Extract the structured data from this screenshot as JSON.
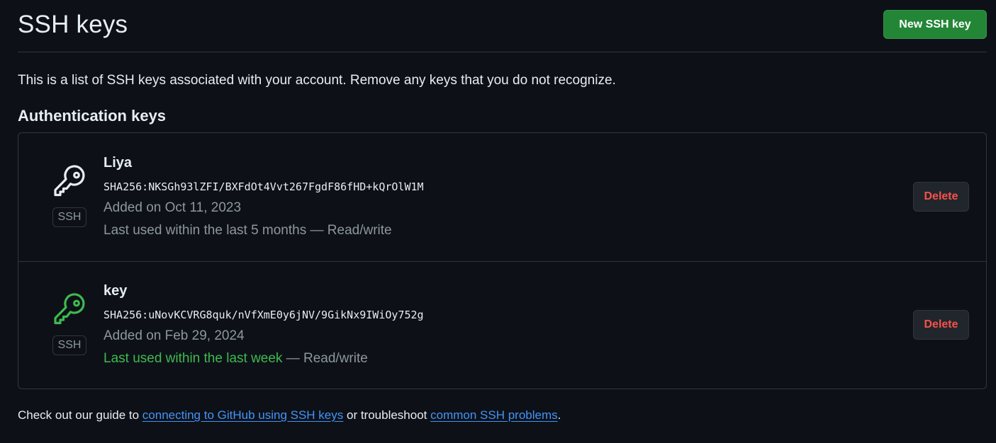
{
  "header": {
    "title": "SSH keys",
    "new_key_label": "New SSH key"
  },
  "description": "This is a list of SSH keys associated with your account. Remove any keys that you do not recognize.",
  "section_title": "Authentication keys",
  "keys": [
    {
      "title": "Liya",
      "fingerprint": "SHA256:NKSGh93lZFI/BXFdOt4Vvt267FgdF86fHD+kQrOlW1M",
      "added": "Added on Oct 11, 2023",
      "usage": "Last used within the last 5 months",
      "access": " — Read/write",
      "badge": "SSH",
      "icon": "key-icon",
      "icon_color": "#e6edf3",
      "delete_label": "Delete"
    },
    {
      "title": "key",
      "fingerprint": "SHA256:uNovKCVRG8quk/nVfXmE0y6jNV/9GikNx9IWiOy752g",
      "added": "Added on Feb 29, 2024",
      "usage": "Last used within the last week",
      "access": " — Read/write",
      "badge": "SSH",
      "icon": "key-icon",
      "icon_color": "#3fb950",
      "delete_label": "Delete"
    }
  ],
  "footer": {
    "prefix": "Check out our guide to ",
    "link1": "connecting to GitHub using SSH keys",
    "middle": " or troubleshoot ",
    "link2": "common SSH problems",
    "suffix": "."
  },
  "colors": {
    "background": "#0d1117",
    "primary_button": "#238636",
    "danger": "#f85149",
    "link": "#4493f8",
    "recent_usage": "#3fb950"
  }
}
